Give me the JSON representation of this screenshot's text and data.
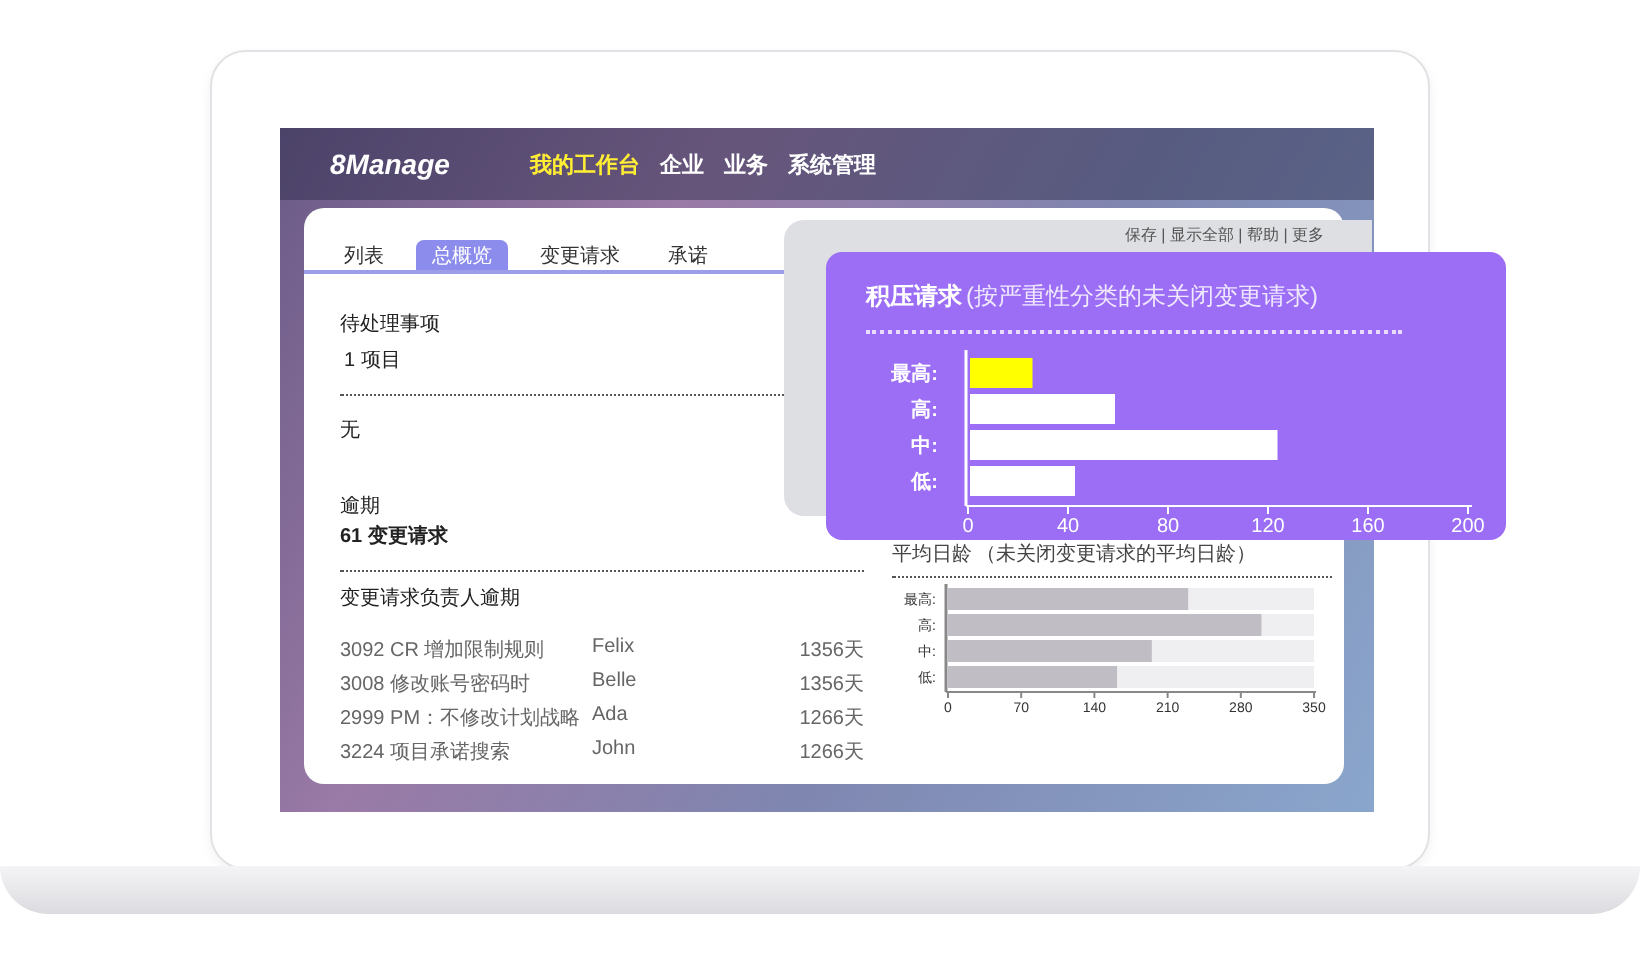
{
  "header": {
    "logo": "8Manage",
    "nav": [
      {
        "label": "我的工作台",
        "selected": true
      },
      {
        "label": "企业",
        "selected": false
      },
      {
        "label": "业务",
        "selected": false
      },
      {
        "label": "系统管理",
        "selected": false
      }
    ]
  },
  "tabs": [
    {
      "label": "列表",
      "selected": false
    },
    {
      "label": "总概览",
      "selected": true
    },
    {
      "label": "变更请求",
      "selected": false
    },
    {
      "label": "承诺",
      "selected": false
    }
  ],
  "toolbar_links": "保存 | 显示全部 | 帮助 | 更多",
  "pending": {
    "title": "待处理事项",
    "value": "1 项目",
    "note": "无"
  },
  "overdue": {
    "title": "逾期",
    "value": "61 变更请求"
  },
  "owner_overdue": {
    "title": "变更请求负责人逾期",
    "rows": [
      {
        "item": "3092 CR 增加限制规则",
        "owner": "Felix",
        "days": "1356天"
      },
      {
        "item": "3008 修改账号密码时",
        "owner": "Belle",
        "days": "1356天"
      },
      {
        "item": "2999 PM：不修改计划战略",
        "owner": "Ada",
        "days": "1266天"
      },
      {
        "item": "3224 项目承诺搜索",
        "owner": "John",
        "days": "1266天"
      }
    ]
  },
  "backlog_chart": {
    "title": "积压请求",
    "subtitle": "(按严重性分类的未关闭变更请求)",
    "label_separator": ":",
    "chart_data": {
      "type": "bar",
      "orientation": "horizontal",
      "categories": [
        "最高",
        "高",
        "中",
        "低"
      ],
      "series": [
        {
          "color": "#ffff00",
          "values": [
            25,
            null,
            null,
            null
          ]
        },
        {
          "color": "#ffffff",
          "values": [
            null,
            58,
            123,
            42
          ]
        }
      ],
      "xlim": [
        0,
        200
      ],
      "xticks": [
        0,
        40,
        80,
        120,
        160,
        200
      ]
    }
  },
  "age_chart": {
    "title": "平均日龄",
    "subtitle": "（未关闭变更请求的平均日龄）",
    "label_separator": ":",
    "chart_data": {
      "type": "bar",
      "orientation": "horizontal",
      "categories": [
        "最高",
        "高",
        "中",
        "低"
      ],
      "series": [
        {
          "color": "#c0bec4",
          "values": [
            230,
            300,
            195,
            162
          ]
        },
        {
          "color": "#efeef0",
          "values": [
            120,
            50,
            155,
            188
          ]
        }
      ],
      "stacked": true,
      "xlim": [
        0,
        350
      ],
      "xticks": [
        0,
        70,
        140,
        210,
        280,
        350
      ]
    }
  }
}
